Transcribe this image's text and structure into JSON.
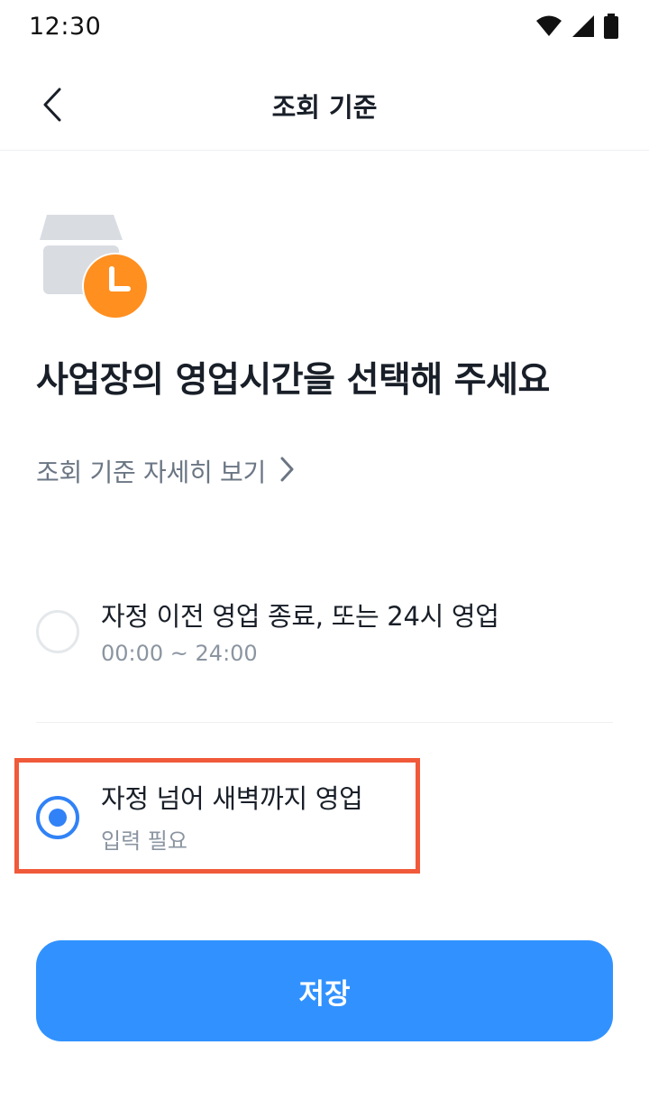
{
  "status_bar": {
    "time": "12:30",
    "icons": [
      "wifi-icon",
      "signal-icon",
      "battery-icon"
    ]
  },
  "header": {
    "back_icon": "chevron-left-icon",
    "title": "조회 기준"
  },
  "hero": {
    "icon": "store-clock-icon"
  },
  "headline": "사업장의 영업시간을 선택해 주세요",
  "detail_link": {
    "label": "조회 기준 자세히 보기",
    "icon": "chevron-right-icon"
  },
  "options": [
    {
      "title": "자정 이전 영업 종료, 또는 24시 영업",
      "subtitle": "00:00 ~ 24:00",
      "selected": false
    },
    {
      "title": "자정 넘어 새벽까지 영업",
      "subtitle": "입력 필요",
      "selected": true
    }
  ],
  "save_button": {
    "label": "저장"
  },
  "colors": {
    "primary": "#3192ff",
    "radio_selected": "#3182f6",
    "highlight": "#f05a3a",
    "clock_badge": "#ff8f1f",
    "text_primary": "#191f28",
    "text_secondary": "#8b95a1"
  }
}
